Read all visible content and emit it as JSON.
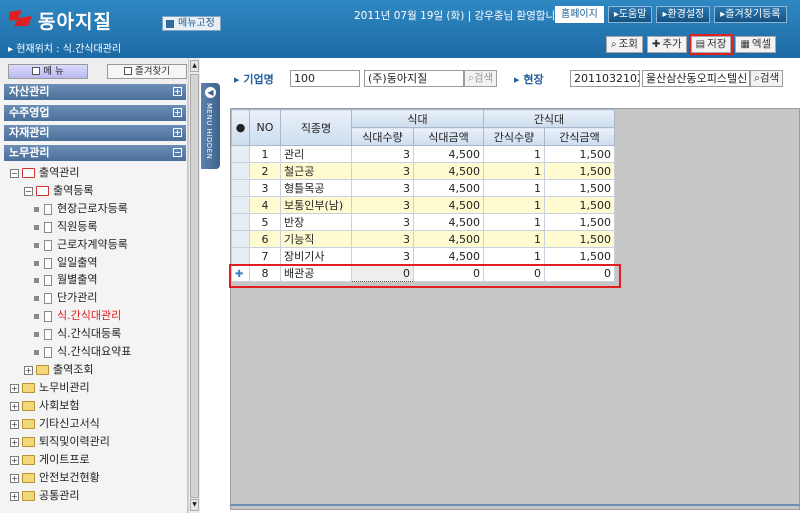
{
  "header": {
    "brand": "동아지질",
    "menu_fix_label": "메뉴고정",
    "welcome": "2011년 07월 19일 (화) | 강우중님 환영합니다.",
    "top_buttons": [
      "홈페이지",
      "▸도움말",
      "▸환경설정",
      "▸즐겨찾기등록"
    ],
    "breadcrumb": "▸ 현재위치 : 식.간식대관리",
    "actions": [
      "조회",
      "추가",
      "저장",
      "엑셀"
    ]
  },
  "sidebar": {
    "tab_menu": "메   뉴",
    "tab_favorites": "즐겨찾기",
    "sections": [
      "자산관리",
      "수주영업",
      "자재관리",
      "노무관리"
    ],
    "tree": [
      {
        "label": "출역관리"
      },
      {
        "label": "출역등록"
      },
      {
        "label": "현장근로자등록"
      },
      {
        "label": "직원등록"
      },
      {
        "label": "근로자계약등록"
      },
      {
        "label": "일일출역"
      },
      {
        "label": "월별출역"
      },
      {
        "label": "단가관리"
      },
      {
        "label": "식.간식대관리"
      },
      {
        "label": "식.간식대등록"
      },
      {
        "label": "식.간식대요약표"
      },
      {
        "label": "출역조회"
      },
      {
        "label": "노무비관리"
      },
      {
        "label": "사회보험"
      },
      {
        "label": "기타신고서식"
      },
      {
        "label": "퇴직및이력관리"
      },
      {
        "label": "게이트프로"
      },
      {
        "label": "안전보건현황"
      },
      {
        "label": "공통관리"
      }
    ],
    "collapse_label": "MENU HIDDEN"
  },
  "search": {
    "company_label": "기업명",
    "company_code": "100",
    "company_name": "(주)동아지질",
    "company_search": "검색",
    "site_label": "현장",
    "site_code": "2011032102",
    "site_name": "울산삼산동오피스텔신",
    "site_search": "검색"
  },
  "grid": {
    "headers": {
      "no": "NO",
      "job": "직종명",
      "meal_group": "식대",
      "snack_group": "간식대",
      "meal_qty": "식대수량",
      "meal_amt": "식대금액",
      "snack_qty": "간식수량",
      "snack_amt": "간식금액"
    },
    "rows": [
      {
        "no": "1",
        "job": "관리",
        "meal_qty": "3",
        "meal_amt": "4,500",
        "snack_qty": "1",
        "snack_amt": "1,500"
      },
      {
        "no": "2",
        "job": "철근공",
        "meal_qty": "3",
        "meal_amt": "4,500",
        "snack_qty": "1",
        "snack_amt": "1,500"
      },
      {
        "no": "3",
        "job": "형틀목공",
        "meal_qty": "3",
        "meal_amt": "4,500",
        "snack_qty": "1",
        "snack_amt": "1,500"
      },
      {
        "no": "4",
        "job": "보통인부(남)",
        "meal_qty": "3",
        "meal_amt": "4,500",
        "snack_qty": "1",
        "snack_amt": "1,500"
      },
      {
        "no": "5",
        "job": "반장",
        "meal_qty": "3",
        "meal_amt": "4,500",
        "snack_qty": "1",
        "snack_amt": "1,500"
      },
      {
        "no": "6",
        "job": "기능직",
        "meal_qty": "3",
        "meal_amt": "4,500",
        "snack_qty": "1",
        "snack_amt": "1,500"
      },
      {
        "no": "7",
        "job": "장비기사",
        "meal_qty": "3",
        "meal_amt": "4,500",
        "snack_qty": "1",
        "snack_amt": "1,500"
      }
    ],
    "new_row": {
      "no": "8",
      "job": "배관공",
      "meal_qty": "0",
      "meal_amt": "0",
      "snack_qty": "0",
      "snack_amt": "0"
    }
  },
  "colors": {
    "header": "#2f88c2",
    "section": "#5a7fa8",
    "highlight": "#e02020",
    "alt_row": "#fffbd0"
  }
}
